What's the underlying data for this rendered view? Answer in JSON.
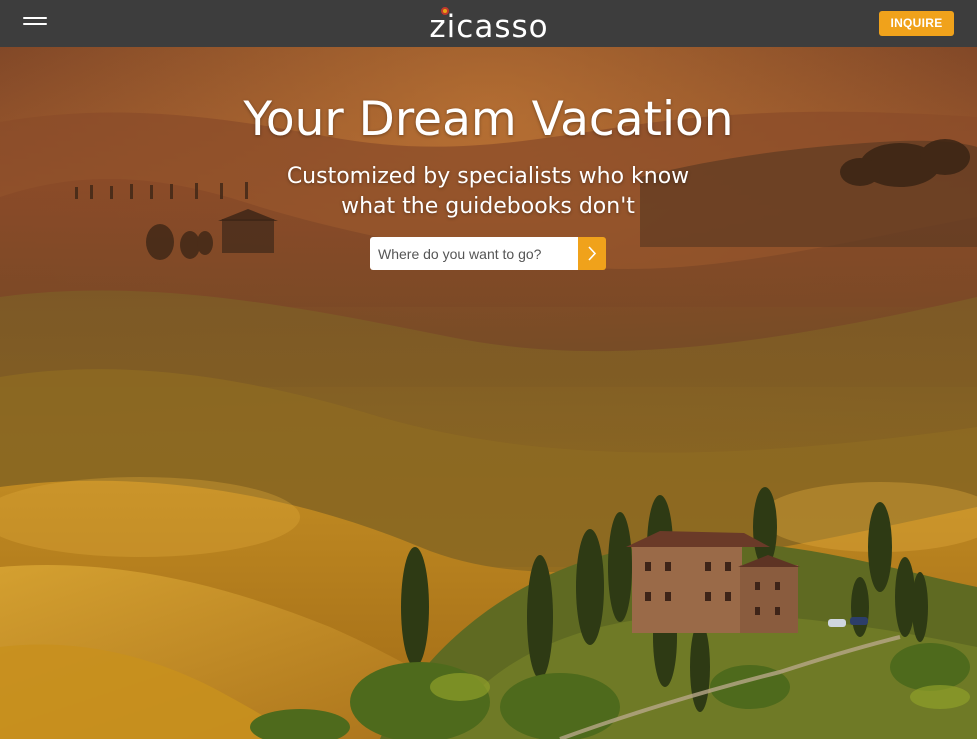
{
  "header": {
    "logo_text": "zicasso",
    "inquire_label": "INQUIRE",
    "menu_icon": "hamburger-icon"
  },
  "hero": {
    "title": "Your Dream Vacation",
    "subtitle_line1": "Customized by specialists who know",
    "subtitle_line2": "what the guidebooks don't",
    "image": "tuscany-landscape-sunset"
  },
  "search": {
    "placeholder": "Where do you want to go?",
    "value": "",
    "button_icon": "chevron-right-icon"
  },
  "colors": {
    "header_bg": "#3d3d3d",
    "accent": "#f0a21b",
    "text_light": "#ffffff"
  }
}
